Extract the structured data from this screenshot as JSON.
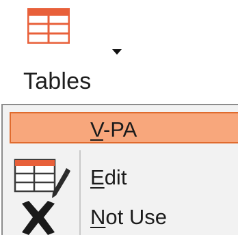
{
  "ribbon": {
    "tables_button": {
      "label": "Tables",
      "icon": "table-icon",
      "dropdown_icon": "dropdown-arrow-icon"
    }
  },
  "menu": {
    "items": [
      {
        "label_prefix": "",
        "label_accel": "V",
        "label_rest": "-PA",
        "icon": "",
        "highlighted": true
      },
      {
        "label_prefix": "",
        "label_accel": "E",
        "label_rest": "dit",
        "icon": "table-edit-icon",
        "highlighted": false
      },
      {
        "label_prefix": "",
        "label_accel": "N",
        "label_rest": "ot Use",
        "icon": "close-x-icon",
        "highlighted": false
      }
    ]
  },
  "colors": {
    "highlight_fill": "#f8a77c",
    "highlight_border": "#e06b2e",
    "icon_accent": "#e8603a",
    "menu_bg": "#f2f2f2"
  }
}
